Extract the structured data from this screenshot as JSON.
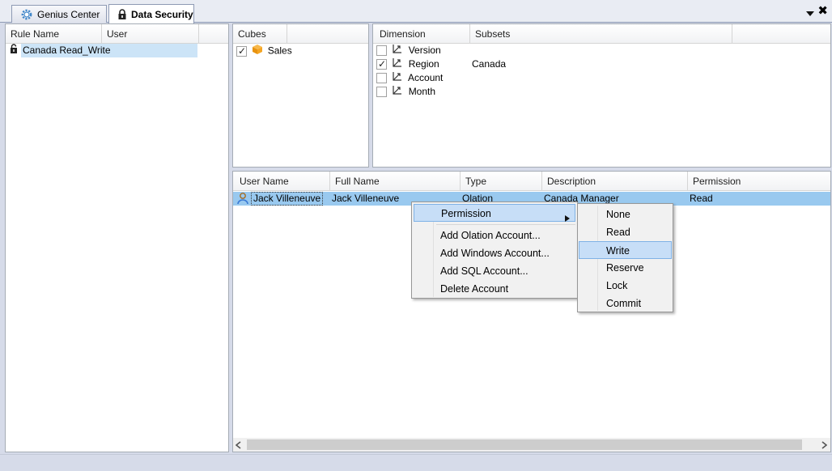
{
  "tabs": [
    {
      "label": "Genius Center",
      "icon": "gear-icon",
      "active": false
    },
    {
      "label": "Data Security",
      "icon": "lock-icon",
      "active": true
    }
  ],
  "tab_controls": {
    "close": "✖"
  },
  "rules_panel": {
    "columns": [
      "Rule Name",
      "User"
    ],
    "rows": [
      {
        "name": "Canada Read_Write",
        "icon": "unlock-icon",
        "selected": true
      }
    ]
  },
  "cubes_panel": {
    "columns": [
      "Cubes"
    ],
    "rows": [
      {
        "name": "Sales",
        "checked": true,
        "icon": "cube-icon"
      }
    ]
  },
  "dimension_panel": {
    "columns": [
      "Dimension",
      "Subsets"
    ],
    "rows": [
      {
        "name": "Version",
        "checked": false,
        "subset": ""
      },
      {
        "name": "Region",
        "checked": true,
        "subset": "Canada"
      },
      {
        "name": "Account",
        "checked": false,
        "subset": ""
      },
      {
        "name": "Month",
        "checked": false,
        "subset": ""
      }
    ]
  },
  "users_panel": {
    "columns": [
      "User Name",
      "Full Name",
      "Type",
      "Description",
      "Permission"
    ],
    "rows": [
      {
        "user_name": "Jack Villeneuve",
        "full_name": "Jack Villeneuve",
        "type": "Olation",
        "description": "Canada Manager",
        "permission": "Read",
        "selected": true
      }
    ]
  },
  "context_menu": {
    "items": [
      {
        "label": "Permission",
        "has_submenu": true,
        "highlighted": true
      },
      {
        "label": "Add Olation Account..."
      },
      {
        "label": "Add Windows Account..."
      },
      {
        "label": "Add SQL Account..."
      },
      {
        "label": "Delete Account"
      }
    ]
  },
  "permission_submenu": {
    "items": [
      "None",
      "Read",
      "Write",
      "Reserve",
      "Lock",
      "Commit"
    ],
    "highlighted": "Write"
  },
  "colors": {
    "selection": "#cce4f7",
    "selection_strong": "#99c9ef",
    "menu_highlight": "#c7def7",
    "window_bg": "#d6dbe9"
  }
}
